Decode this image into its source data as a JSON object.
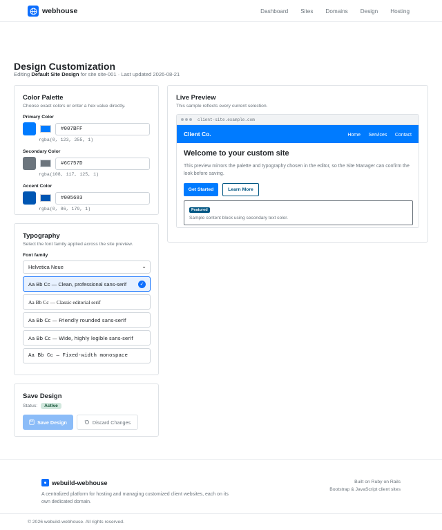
{
  "nav": {
    "brand": "webhouse",
    "links": [
      "Dashboard",
      "Sites",
      "Domains",
      "Design",
      "Hosting"
    ]
  },
  "header": {
    "title": "Design Customization",
    "sub_prefix": "Editing",
    "design_name": "Default Site Design",
    "sub_suffix": "for site site-001 · Last updated 2026-08-21"
  },
  "palette": {
    "title": "Color Palette",
    "desc": "Choose exact colors or enter a hex value directly.",
    "colors": [
      {
        "label": "Primary Color",
        "hex": "#007BFF",
        "rgba": "rgba(0, 123, 255, 1)"
      },
      {
        "label": "Secondary Color",
        "hex": "#6C757D",
        "rgba": "rgba(108, 117, 125, 1)"
      },
      {
        "label": "Accent Color",
        "hex": "#005683",
        "rgba": "rgba(0, 86, 179, 1)"
      }
    ]
  },
  "typography": {
    "title": "Typography",
    "desc": "Select the font family applied across the site preview.",
    "font_label": "Font family",
    "selected": "Helvetica Neue",
    "options": [
      "Aa Bb Cc — Clean, professional sans-serif",
      "Aa Bb Cc — Classic editorial serif",
      "Aa Bb Cc — Friendly rounded sans-serif",
      "Aa Bb Cc — Wide, highly legible sans-serif",
      "Aa Bb Cc — Fixed-width monospace"
    ]
  },
  "save": {
    "title": "Save Design",
    "status_label": "Status:",
    "status": "Active",
    "save_label": "Save Design",
    "discard_label": "Discard Changes"
  },
  "preview": {
    "title": "Live Preview",
    "desc": "This sample reflects every current selection.",
    "url": "client-site.example.com",
    "site_brand": "Client Co.",
    "site_links": [
      "Home",
      "Services",
      "Contact"
    ],
    "heading": "Welcome to your custom site",
    "paragraph": "This preview mirrors the palette and typography chosen in the editor, so the Site Manager can confirm the look before saving.",
    "btn_primary": "Get Started",
    "btn_secondary": "Learn More",
    "badge": "Featured",
    "block_text": "Sample content block using secondary text color."
  },
  "footer": {
    "brand": "webuild-webhouse",
    "desc": "A centralized platform for hosting and managing customized client websites, each on its own dedicated domain.",
    "right_1": "Built on Ruby on Rails",
    "right_2": "Bootstrap & JavaScript client sites",
    "copyright": "© 2026 webuild-webhouse. All rights reserved."
  },
  "colors": {
    "brand": "#0d6efd",
    "primary": "#007BFF",
    "secondary": "#6C757D",
    "accent": "#005683"
  },
  "icons": [
    "globe-icon",
    "chevron-down-icon",
    "check-icon",
    "save-icon",
    "undo-icon"
  ]
}
